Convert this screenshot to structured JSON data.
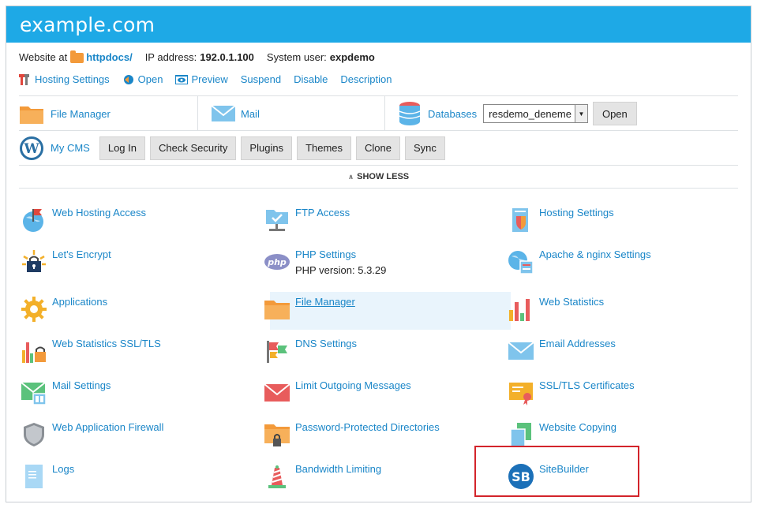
{
  "header": {
    "title": "example.com"
  },
  "info": {
    "website_prefix": "Website at",
    "docroot": "httpdocs/",
    "ip_label": "IP address:",
    "ip_value": "192.0.1.100",
    "user_label": "System user:",
    "user_value": "expdemo"
  },
  "actions": {
    "hosting_settings": "Hosting Settings",
    "open": "Open",
    "preview": "Preview",
    "suspend": "Suspend",
    "disable": "Disable",
    "description": "Description"
  },
  "quick": {
    "file_manager": "File Manager",
    "mail": "Mail",
    "databases": "Databases",
    "db_selected": "resdemo_deneme",
    "db_open": "Open"
  },
  "cms": {
    "label": "My CMS",
    "buttons": [
      "Log In",
      "Check Security",
      "Plugins",
      "Themes",
      "Clone",
      "Sync"
    ]
  },
  "toggle": {
    "label": "SHOW LESS"
  },
  "tools": {
    "web_hosting_access": "Web Hosting Access",
    "ftp_access": "FTP Access",
    "hosting_settings": "Hosting Settings",
    "lets_encrypt": "Let's Encrypt",
    "php_settings": "PHP Settings",
    "php_version": "PHP version: 5.3.29",
    "apache_nginx": "Apache & nginx Settings",
    "applications": "Applications",
    "file_manager": "File Manager",
    "web_statistics": "Web Statistics",
    "web_stats_ssl": "Web Statistics SSL/TLS",
    "dns_settings": "DNS Settings",
    "email_addresses": "Email Addresses",
    "mail_settings": "Mail Settings",
    "limit_outgoing": "Limit Outgoing Messages",
    "ssl_certs": "SSL/TLS Certificates",
    "waf": "Web Application Firewall",
    "password_dirs": "Password-Protected Directories",
    "website_copying": "Website Copying",
    "logs": "Logs",
    "bandwidth": "Bandwidth Limiting",
    "sitebuilder": "SiteBuilder",
    "sitebuilder_logo": "SB"
  },
  "colors": {
    "header": "#1ea9e6",
    "link": "#1a86c8",
    "highlight": "#d3242b"
  }
}
